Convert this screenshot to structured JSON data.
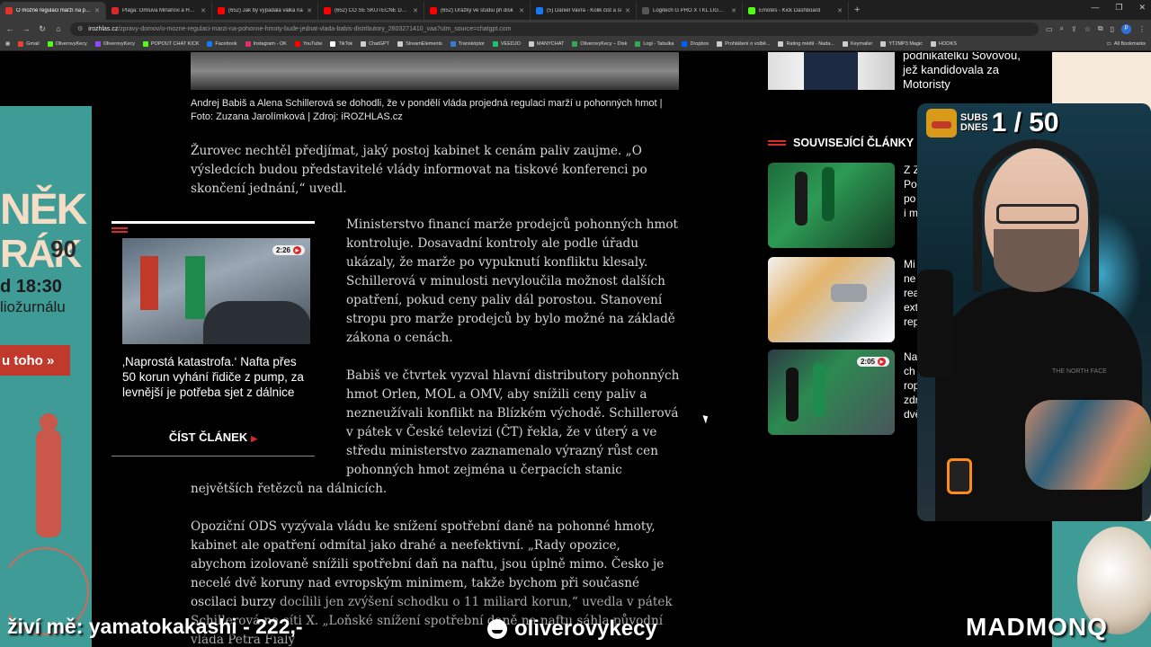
{
  "browser": {
    "tabs": [
      {
        "title": "O možné regulaci marží na poh",
        "color": "#e6332a",
        "active": true
      },
      {
        "title": "Plaga: Omluva Minářovi a Halik",
        "color": "#d72b2b",
        "active": false
      },
      {
        "title": "(652) Jak by vypadala válka na",
        "color": "#ff0000",
        "active": false
      },
      {
        "title": "(652) CO SE SKUTEČNĚ DĚLO h",
        "color": "#ff0000",
        "active": false
      },
      {
        "title": "(652) Urážky ve studiu při disk",
        "color": "#ff0000",
        "active": false
      },
      {
        "title": "(5) Daniel Vavra - Kolik čist a si",
        "color": "#1877f2",
        "active": false
      },
      {
        "title": "Logitech G PRO X TKL LIGHTSP",
        "color": "#555555",
        "active": false
      },
      {
        "title": "Emotes - Kick Dashboard",
        "color": "#53fc18",
        "active": false
      }
    ],
    "new_tab": "+",
    "window_controls": [
      "—",
      "❐",
      "✕"
    ],
    "address": {
      "host": "irozhlas.cz",
      "path": "/zpravy-domov/o-mozne-regulaci-marzi-na-pohonne-hmoty-bude-jednat-vlada-babis-distributory_2603271410_vaa?utm_source=chatgpt.com"
    },
    "bookmarks": [
      {
        "label": "Gmail",
        "color": "#ea4335"
      },
      {
        "label": "OliverovyKecy",
        "color": "#53fc18"
      },
      {
        "label": "OliverovyKecy",
        "color": "#9146ff"
      },
      {
        "label": "POPOUT CHAT KICK",
        "color": "#53fc18"
      },
      {
        "label": "Facebook",
        "color": "#1877f2"
      },
      {
        "label": "Instagram - OK",
        "color": "#e1306c"
      },
      {
        "label": "YouTube",
        "color": "#ff0000"
      },
      {
        "label": "TikTok",
        "color": "#ffffff"
      },
      {
        "label": "ChatGPT",
        "color": "#cccccc"
      },
      {
        "label": "StreamElements",
        "color": "#cccccc"
      },
      {
        "label": "Transkriptor",
        "color": "#3a7bd5"
      },
      {
        "label": "VEEDJO",
        "color": "#1fbf73"
      },
      {
        "label": "MANYCHAT",
        "color": "#cccccc"
      },
      {
        "label": "OliverovyKecy – Disk",
        "color": "#34a853"
      },
      {
        "label": "Logi - Tabulka",
        "color": "#34a853"
      },
      {
        "label": "Dropbox",
        "color": "#0061ff"
      },
      {
        "label": "Prohlášení o volbě...",
        "color": "#cccccc"
      },
      {
        "label": "Rating médií - Nada...",
        "color": "#cccccc"
      },
      {
        "label": "Keymailer",
        "color": "#cccccc"
      },
      {
        "label": "YT2MP3 Magic",
        "color": "#cccccc"
      },
      {
        "label": "HOOKS",
        "color": "#cccccc"
      }
    ],
    "all_bookmarks": "All Bookmarks"
  },
  "left_ad": {
    "line1": "NĚK",
    "line2": "RÁK",
    "number": "90",
    "time": "d 18:30",
    "text": "liožurnálu",
    "cta": "u toho »"
  },
  "article": {
    "caption": "Andrej Babiš a Alena Schillerová se dohodli, že v pondělí vláda projedná regulaci marží u pohonných hmot | Foto: Zuzana Jarolímková | Zdroj: iROZHLAS.cz",
    "p1": "Žurovec nechtěl předjímat, jaký postoj kabinet k cenám paliv zaujme. „O výsledcích budou představitelé vlády informovat na tiskové konferenci po skončení jednání,“ uvedl.",
    "p2": "Ministerstvo financí marže prodejců pohonných hmot kontroluje. Dosavadní kontroly ale podle úřadu ukázaly, že marže po vypuknutí konfliktu klesaly. Schillerová v minulosti nevyloučila možnost dalších opatření, pokud ceny paliv dál porostou. Stanovení stropu pro marže prodejců by bylo možné na základě zákona o cenách.",
    "p3": "Babiš ve čtvrtek vyzval hlavní distributory pohonných hmot Orlen, MOL a OMV, aby snížili ceny paliv a nezneužívali konflikt na Blízkém východě. Schillerová v pátek v České televizi (ČT) řekla, že v úterý a ve středu ministerstvo zaznamenalo výrazný růst cen pohonných hmot zejména u čerpacích stanic",
    "p3_end": "největších řetězců na dálnicích.",
    "p4": "Opoziční ODS vyzývala vládu ke snížení spotřební daně na pohonné hmoty, kabinet ale opatření odmítal jako drahé a neefektivní. „Rady opozice, abychom izolovaně snížili spotřební daň na naftu, jsou úplně mimo. Česko je necelé dvě koruny nad evropským minimem, takže bychom při současné oscilaci burzy",
    "p4_fade": "docílili jen zvýšení schodku o 11 miliard korun,“ uvedla v pátek Schillerová na síti X. „Loňské snížení spotřební daně na naftu sáhla původní vláda Petra Fialy"
  },
  "inline_related": {
    "duration": "2:26",
    "title": "‚Naprostá katastrofa.‘ Nafta přes 50 korun vyhání řidiče z pump, za levnější je potřeba sjet z dálnice",
    "read_more": "ČÍST ČLÁNEK"
  },
  "right_column": {
    "top_text": "podnikatelku Sovovou, jež kandidovala za Motoristy",
    "related_heading": "SOUVISEJÍCÍ ČLÁNKY",
    "items": [
      {
        "text": "Z Z\nPo\npo\ni m",
        "duration": ""
      },
      {
        "text": "Mi\nne\nrea\next\nrep",
        "duration": ""
      },
      {
        "text": "Na\nch\nrop\nzdr\ndvě",
        "duration": "2:05"
      }
    ]
  },
  "stream": {
    "subs_label_1": "SUBS",
    "subs_label_2": "DNES",
    "subs_count": "1 / 50",
    "ticker": "živí mě: yamatokakashi - 222,-",
    "handle": "oliverovykecy",
    "brand": "MADMONQ",
    "shirt_logo": "THE NORTH FACE"
  }
}
